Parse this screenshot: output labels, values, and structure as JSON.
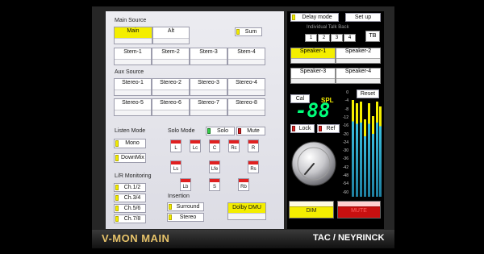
{
  "title": "V-MON MAIN",
  "brand": "TAC / NEYRINCK",
  "main_source": {
    "label": "Main Source",
    "buttons": [
      {
        "label": "Main",
        "selected": true
      },
      {
        "label": "Alt",
        "selected": false
      }
    ],
    "sum": "Sum",
    "stems": [
      "Stem-1",
      "Stem-2",
      "Stem-3",
      "Stem-4"
    ]
  },
  "aux_source": {
    "label": "Aux Source",
    "row1": [
      "Stereo-1",
      "Stereo-2",
      "Stereo-3",
      "Stereo-4"
    ],
    "row2": [
      "Stereo-5",
      "Stereo-6",
      "Stereo-7",
      "Stereo-8"
    ]
  },
  "listen_mode": {
    "label": "Listen Mode",
    "mono": "Mono",
    "downmix": "DownMix"
  },
  "solo_mode": {
    "label": "Solo Mode",
    "solo": "Solo",
    "mute": "Mute",
    "row1": [
      "L",
      "Lc",
      "C",
      "Rc",
      "R"
    ],
    "row2": [
      "Ls",
      "Lfe",
      "Rs"
    ],
    "row3": [
      "Lb",
      "S",
      "Rb"
    ]
  },
  "lr_monitoring": {
    "label": "L/R Monitoring",
    "items": [
      "Ch.1/2",
      "Ch.3/4",
      "Ch.5/6",
      "Ch.7/8"
    ]
  },
  "insertion": {
    "label": "Insertion",
    "surround": "Surround",
    "stereo": "Stereo"
  },
  "dolby": "Dolby DMU",
  "right": {
    "delay_mode": "Delay mode",
    "setup": "Set up",
    "talkback_label": "Individual Talk Back",
    "talkback": [
      "1",
      "2",
      "3",
      "4"
    ],
    "tb": "TB",
    "speakers": [
      {
        "label": "Speaker-1",
        "selected": true
      },
      {
        "label": "Speaker-2",
        "selected": false
      },
      {
        "label": "Speaker-3",
        "selected": false
      },
      {
        "label": "Speaker-4",
        "selected": false
      }
    ],
    "cal": "Cal",
    "spl": "SPL",
    "reset": "Reset",
    "readout": "-88",
    "lock": "Lock",
    "ref": "Ref",
    "scale": [
      "0",
      "-4",
      "-8",
      "-12",
      "-16",
      "-20",
      "-24",
      "-30",
      "-36",
      "-42",
      "-48",
      "-54",
      "-60"
    ],
    "dim": "DIM",
    "mute": "MUTE"
  },
  "colors": {
    "accent": "#f4ee00",
    "mute_red": "#e02020",
    "readout": "#00ff7a",
    "meter": "#3bc0e0"
  }
}
